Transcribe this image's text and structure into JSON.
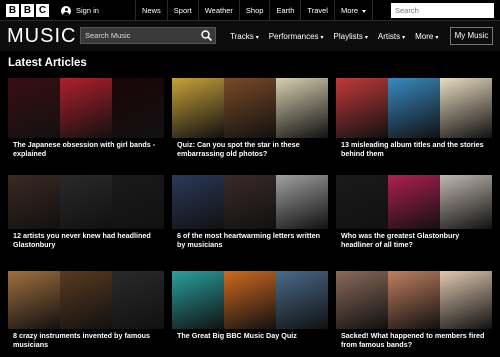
{
  "bbc_bar": {
    "logo_letters": [
      "B",
      "B",
      "C"
    ],
    "signin_label": "Sign in",
    "nav": [
      "News",
      "Sport",
      "Weather",
      "Shop",
      "Earth",
      "Travel"
    ],
    "more_label": "More",
    "search_placeholder": "Search"
  },
  "music_header": {
    "title": "MUSIC",
    "search_placeholder": "Search Music",
    "nav": [
      "Tracks",
      "Performances",
      "Playlists",
      "Artists",
      "More"
    ],
    "caret": "▾",
    "my_music_label": "My Music"
  },
  "section": {
    "title": "Latest Articles"
  },
  "articles": [
    {
      "caption": "The Japanese obsession with girl bands - explained",
      "colors": [
        "#3a0d12",
        "#b0202c",
        "#1a0508"
      ]
    },
    {
      "caption": "Quiz: Can you spot the star in these embarrassing old photos?",
      "colors": [
        "#c8a23a",
        "#7a4a28",
        "#d8d0b0"
      ]
    },
    {
      "caption": "13 misleading album titles and the stories behind them",
      "colors": [
        "#c23a3a",
        "#3a8ac0",
        "#e8dcc0"
      ]
    },
    {
      "caption": "12 artists you never knew had headlined Glastonbury",
      "colors": [
        "#3a2a22",
        "#2a2a2a",
        "#1a1a1a"
      ]
    },
    {
      "caption": "6 of the most heartwarming letters written by musicians",
      "colors": [
        "#2a3a5a",
        "#3a2a2a",
        "#a0a0a0"
      ]
    },
    {
      "caption": "Who was the greatest Glastonbury headliner of all time?",
      "colors": [
        "#1a1a1a",
        "#b02050",
        "#c0b8b0"
      ]
    },
    {
      "caption": "8 crazy instruments invented by famous musicians",
      "colors": [
        "#a07040",
        "#5a3a20",
        "#2a2a2a"
      ]
    },
    {
      "caption": "The Great Big BBC Music Day Quiz",
      "colors": [
        "#2aa0a0",
        "#d06a20",
        "#4a6a8a"
      ]
    },
    {
      "caption": "Sacked! What happened to members fired from famous bands?",
      "colors": [
        "#8a6a5a",
        "#c08060",
        "#e0c8b0"
      ]
    }
  ]
}
